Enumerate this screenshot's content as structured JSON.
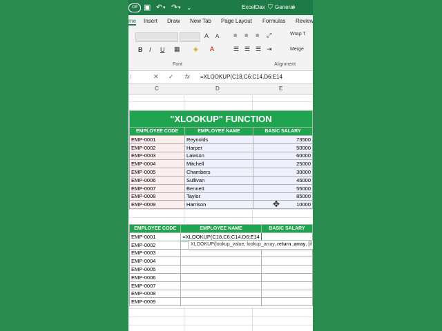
{
  "qat": {
    "autosave": "Off",
    "title": "ExcelDax",
    "sensitivity": "General"
  },
  "tabs": [
    {
      "label": "me"
    },
    {
      "label": "Insert"
    },
    {
      "label": "Draw"
    },
    {
      "label": "New Tab"
    },
    {
      "label": "Page Layout"
    },
    {
      "label": "Formulas"
    },
    {
      "label": "Review"
    }
  ],
  "ribbon": {
    "bold": "B",
    "italic": "I",
    "underline": "U",
    "font_group": "Font",
    "alignment_group": "Alignment",
    "wrap_text": "Wrap T",
    "merge": "Merge"
  },
  "formula_bar": {
    "formula": "=XLOOKUP(C18,C6:C14,D6:E14"
  },
  "columns": [
    "C",
    "D",
    "E"
  ],
  "table1": {
    "title": "\"XLOOKUP\" FUNCTION",
    "headers": [
      "EMPLOYEE CODE",
      "EMPLOYEE  NAME",
      "BASIC SALARY"
    ],
    "rows": [
      {
        "code": "EMP-0001",
        "name": "Reynolds",
        "salary": "73500"
      },
      {
        "code": "EMP-0002",
        "name": "Harper",
        "salary": "50000"
      },
      {
        "code": "EMP-0003",
        "name": "Lawson",
        "salary": "60000"
      },
      {
        "code": "EMP-0004",
        "name": "Mitchell",
        "salary": "25000"
      },
      {
        "code": "EMP-0005",
        "name": "Chambers",
        "salary": "30000"
      },
      {
        "code": "EMP-0006",
        "name": "Sullivan",
        "salary": "45000"
      },
      {
        "code": "EMP-0007",
        "name": "Bennett",
        "salary": "55000"
      },
      {
        "code": "EMP-0008",
        "name": "Taylor",
        "salary": "85000"
      },
      {
        "code": "EMP-0009",
        "name": "Harrison",
        "salary": "10000"
      }
    ]
  },
  "table2": {
    "headers": [
      "EMPLOYEE CODE",
      "EMPLOYEE  NAME",
      "BASIC SALARY"
    ],
    "edit_formula": "=XLOOKUP(C18,C6:C14,D6:E14",
    "rows": [
      {
        "code": "EMP-0001"
      },
      {
        "code": "EMP-0002"
      },
      {
        "code": "EMP-0003"
      },
      {
        "code": "EMP-0004"
      },
      {
        "code": "EMP-0005"
      },
      {
        "code": "EMP-0006"
      },
      {
        "code": "EMP-0007"
      },
      {
        "code": "EMP-0008"
      },
      {
        "code": "EMP-0009"
      }
    ]
  },
  "tooltip": {
    "prefix": "XLOOKUP(lookup_value, lookup_array, ",
    "bold": "return_array",
    "suffix": ", [if"
  },
  "colors": {
    "header_green": "#1fa54f",
    "background_green": "#2a8c50"
  }
}
